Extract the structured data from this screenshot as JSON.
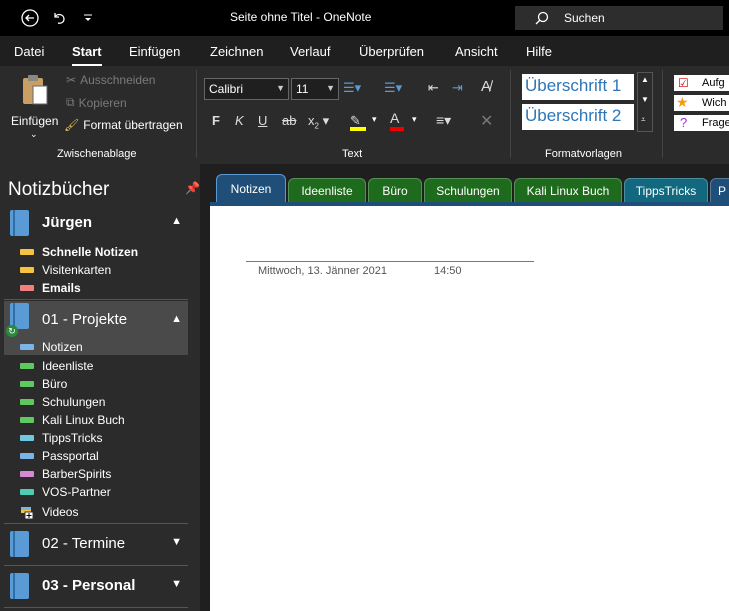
{
  "titlebar": {
    "back_icon": "back-arrow-icon",
    "undo_icon": "undo-icon",
    "customize_icon": "customize-caret-icon",
    "title": "Seite ohne Titel  -  OneNote",
    "search_label": "Suchen"
  },
  "menu": {
    "tabs": [
      "Datei",
      "Start",
      "Einfügen",
      "Zeichnen",
      "Verlauf",
      "Überprüfen",
      "Ansicht",
      "Hilfe"
    ],
    "active": "Start"
  },
  "ribbon": {
    "clipboard": {
      "paste": "Einfügen",
      "cut": "Ausschneiden",
      "copy": "Kopieren",
      "format_painter": "Format übertragen",
      "group": "Zwischenablage"
    },
    "text": {
      "font": "Calibri",
      "size": "11",
      "bold": "F",
      "italic": "K",
      "underline": "U",
      "strike": "ab",
      "subscript": "x",
      "group": "Text"
    },
    "styles": {
      "h1": "Überschrift 1",
      "h2": "Überschrift 2",
      "group": "Formatvorlagen"
    },
    "tags": [
      "Aufg",
      "Wich",
      "Frage"
    ]
  },
  "nav": {
    "title": "Notizbücher",
    "notebooks": [
      {
        "name": "Jürgen",
        "expanded": true
      },
      {
        "name": "01 - Projekte",
        "expanded": true
      },
      {
        "name": "02 - Termine",
        "expanded": false
      },
      {
        "name": "03 - Personal",
        "expanded": false
      }
    ],
    "juergen_sections": [
      {
        "label": "Schnelle Notizen",
        "color": "#f5c242",
        "bold": true
      },
      {
        "label": "Visitenkarten",
        "color": "#f5c242",
        "bold": false
      },
      {
        "label": "Emails",
        "color": "#f08080",
        "bold": true
      }
    ],
    "projekte_sections": [
      {
        "label": "Notizen",
        "color": "#7ab4e8"
      },
      {
        "label": "Ideenliste",
        "color": "#5ec95e"
      },
      {
        "label": "Büro",
        "color": "#5ec95e"
      },
      {
        "label": "Schulungen",
        "color": "#5ec95e"
      },
      {
        "label": "Kali Linux Buch",
        "color": "#5ec95e"
      },
      {
        "label": "TippsTricks",
        "color": "#6fc7e0"
      },
      {
        "label": "Passportal",
        "color": "#7ab4e8"
      },
      {
        "label": "BarberSpirits",
        "color": "#d68ad6"
      },
      {
        "label": "VOS-Partner",
        "color": "#4ecbb3"
      },
      {
        "label": "Videos",
        "color": "#ffffff"
      }
    ]
  },
  "section_tabs": [
    {
      "label": "Notizen",
      "color": "#1f4e79",
      "active": true
    },
    {
      "label": "Ideenliste",
      "color": "#1e6b1e"
    },
    {
      "label": "Büro",
      "color": "#1e6b1e"
    },
    {
      "label": "Schulungen",
      "color": "#1e6b1e"
    },
    {
      "label": "Kali Linux Buch",
      "color": "#1e6b1e"
    },
    {
      "label": "TippsTricks",
      "color": "#11687f"
    },
    {
      "label": "P",
      "color": "#1f4e79"
    }
  ],
  "page": {
    "date": "Mittwoch, 13. Jänner 2021",
    "time": "14:50"
  }
}
